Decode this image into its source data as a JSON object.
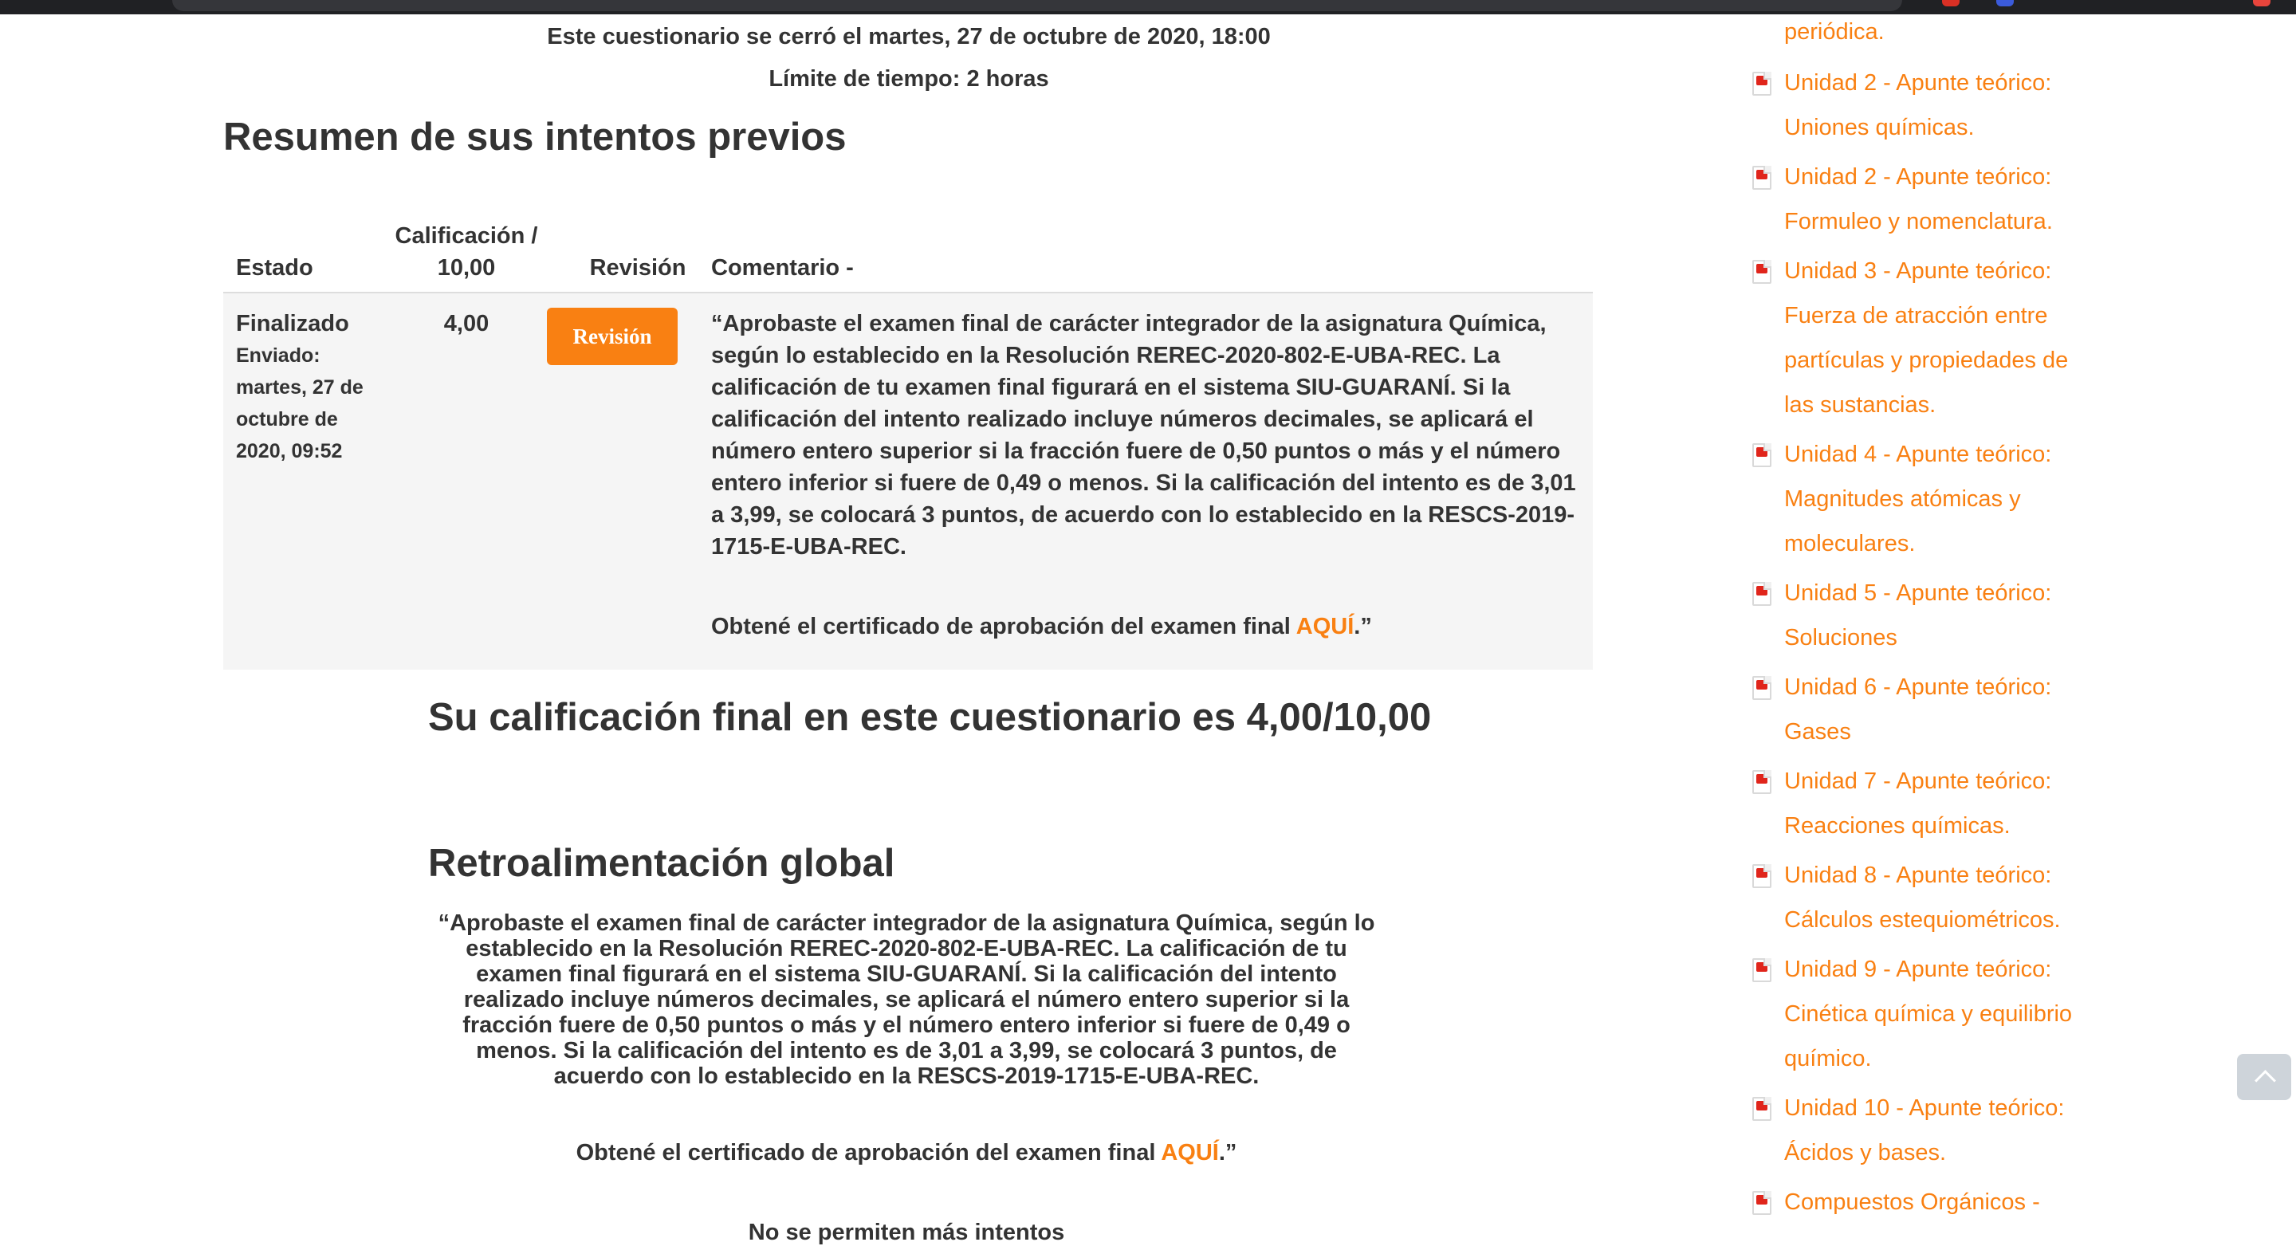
{
  "quiz": {
    "closed_notice": "Este cuestionario se cerró el martes, 27 de octubre de 2020, 18:00",
    "time_limit": "Límite de tiempo: 2 horas"
  },
  "summary": {
    "heading": "Resumen de sus intentos previos",
    "columns": {
      "estado": "Estado",
      "calificacion": "Calificación / 10,00",
      "revision": "Revisión",
      "comentario": "Comentario -"
    },
    "attempt": {
      "state": "Finalizado",
      "submitted": "Enviado: martes, 27 de octubre de 2020, 09:52",
      "grade": "4,00",
      "review_button": "Revisión",
      "comment": "“Aprobaste el examen final de carácter integrador de la asignatura Química, según lo establecido en la Resolución REREC-2020-802-E-UBA-REC. La calificación de tu examen final figurará en el sistema SIU-GUARANÍ. Si la calificación del intento realizado incluye números decimales, se aplicará el número entero superior si la fracción fuere de 0,50 puntos o más y el número entero inferior si fuere de 0,49 o menos. Si la calificación del intento es de 3,01 a 3,99, se colocará 3 puntos, de acuerdo con lo establecido en la RESCS-2019-1715-E-UBA-REC.",
      "cert_prefix": "Obtené el certificado de aprobación del examen final ",
      "cert_link": "AQUÍ",
      "cert_suffix": ".”"
    }
  },
  "final_grade": {
    "text": "Su calificación final en este cuestionario es 4,00/10,00"
  },
  "feedback": {
    "heading": "Retroalimentación global",
    "text": "“Aprobaste el examen final de carácter integrador de la asignatura Química, según lo establecido en la Resolución REREC-2020-802-E-UBA-REC. La calificación de tu examen final figurará en el sistema SIU-GUARANÍ. Si la calificación del intento realizado incluye números decimales, se aplicará el número entero superior si la fracción fuere de 0,50 puntos o más y el número entero inferior si fuere de 0,49 o menos. Si la calificación del intento es de 3,01 a 3,99, se colocará 3 puntos, de acuerdo con lo establecido en la RESCS-2019-1715-E-UBA-REC.",
    "cert_prefix": "Obtené el certificado de aprobación del examen final ",
    "cert_link": "AQUÍ",
    "cert_suffix": ".”"
  },
  "no_more_attempts": "No se permiten más intentos",
  "sidebar": {
    "items": [
      {
        "label": "periódica.",
        "icon": "pdf-icon"
      },
      {
        "label": "Unidad 2 - Apunte teórico: Uniones químicas.",
        "icon": "pdf-icon"
      },
      {
        "label": "Unidad 2 - Apunte teórico: Formuleo y nomenclatura.",
        "icon": "pdf-icon"
      },
      {
        "label": "Unidad 3 - Apunte teórico: Fuerza de atracción entre partículas y propiedades de las sustancias.",
        "icon": "pdf-icon"
      },
      {
        "label": "Unidad 4 - Apunte teórico: Magnitudes atómicas y moleculares.",
        "icon": "pdf-icon"
      },
      {
        "label": "Unidad 5 - Apunte teórico: Soluciones",
        "icon": "pdf-icon"
      },
      {
        "label": "Unidad 6 - Apunte teórico: Gases",
        "icon": "pdf-icon"
      },
      {
        "label": "Unidad 7 - Apunte teórico: Reacciones químicas.",
        "icon": "pdf-icon"
      },
      {
        "label": "Unidad 8 - Apunte teórico: Cálculos estequiométricos.",
        "icon": "pdf-icon"
      },
      {
        "label": "Unidad 9 - Apunte teórico: Cinética química y equilibrio químico.",
        "icon": "pdf-icon"
      },
      {
        "label": "Unidad 10 - Apunte teórico: Ácidos y bases.",
        "icon": "pdf-icon"
      },
      {
        "label": "Compuestos Orgánicos -",
        "icon": "pdf-icon"
      }
    ]
  },
  "colors": {
    "accent": "#f98012",
    "text": "#333333",
    "row_bg": "#f5f5f5",
    "topbar": "#202124"
  }
}
